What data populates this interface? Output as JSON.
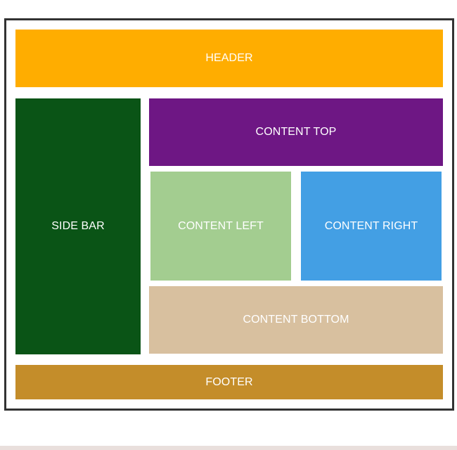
{
  "layout": {
    "header": {
      "label": "HEADER",
      "color": "#ffad00"
    },
    "sidebar": {
      "label": "SIDE BAR",
      "color": "#0a5416"
    },
    "content_top": {
      "label": "CONTENT TOP",
      "color": "#6e1784"
    },
    "content_left": {
      "label": "CONTENT LEFT",
      "color": "#a3cd90"
    },
    "content_right": {
      "label": "CONTENT RIGHT",
      "color": "#439fe4"
    },
    "content_bottom": {
      "label": "CONTENT BOTTOM",
      "color": "#d8c09f"
    },
    "footer": {
      "label": "FOOTER",
      "color": "#c48d2a"
    }
  },
  "colors": {
    "frame_border": "#333333",
    "background": "#ffffff",
    "text": "#ffffff"
  }
}
